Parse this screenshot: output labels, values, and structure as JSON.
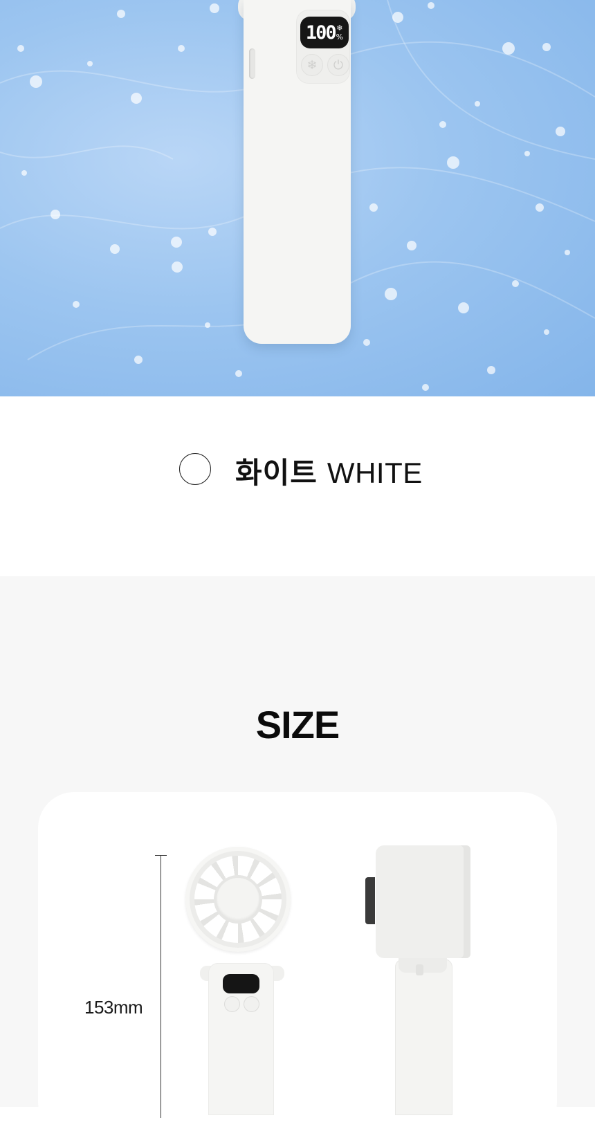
{
  "hero": {
    "display_value": "100",
    "display_unit": "%",
    "snowflake_symbol": "❄",
    "power_symbol": "⏻",
    "colors": {
      "sky_light": "#b9d6f6",
      "sky_dark": "#84b5ea",
      "product": "#f5f5f3"
    }
  },
  "color_option": {
    "name_ko": "화이트",
    "name_en": "WHITE",
    "swatch_color": "#ffffff"
  },
  "size": {
    "title": "SIZE",
    "height_label": "153mm"
  }
}
